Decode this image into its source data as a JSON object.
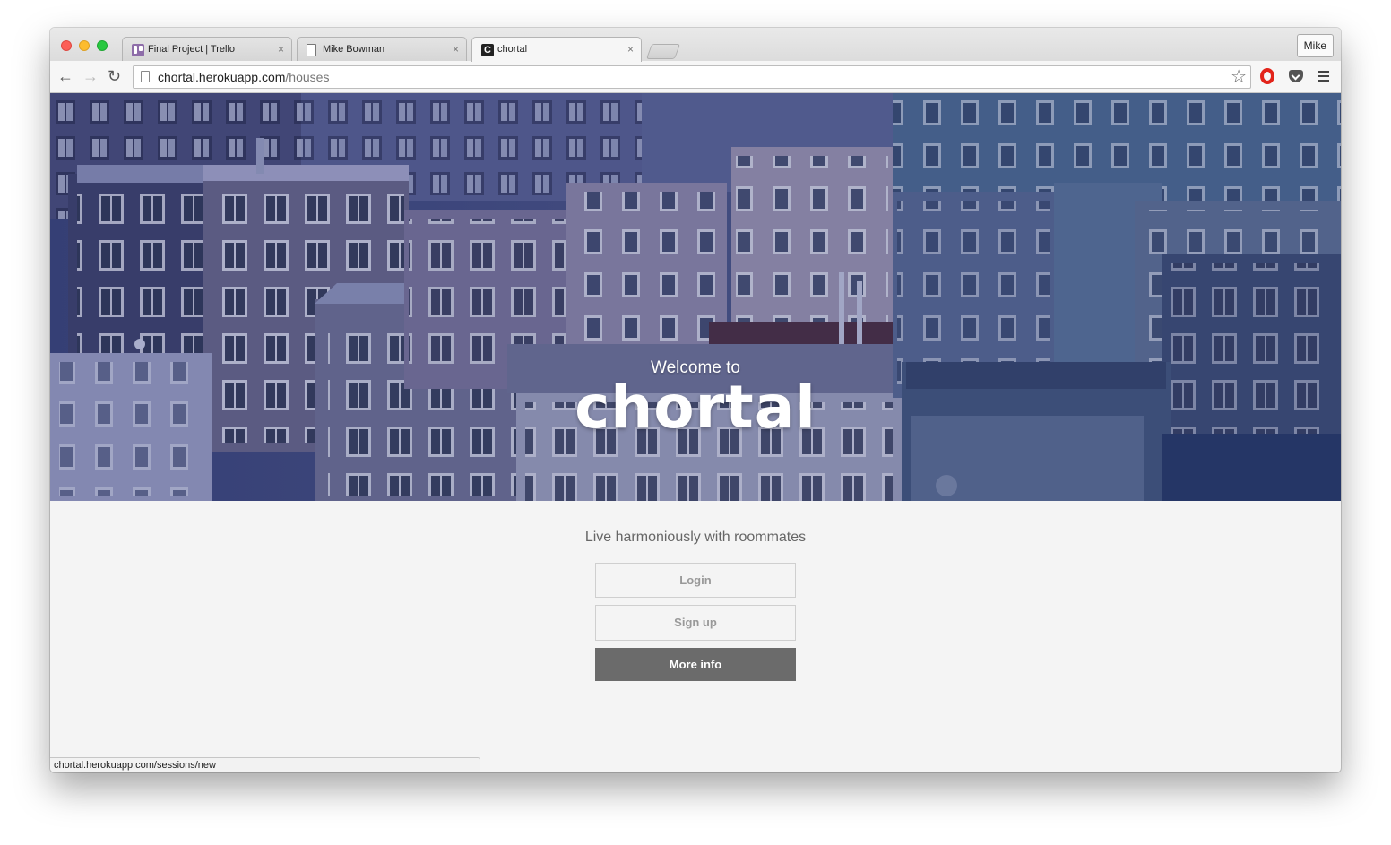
{
  "browser": {
    "tabs": [
      {
        "label": "Final Project | Trello",
        "icon": "trello-icon"
      },
      {
        "label": "Mike Bowman",
        "icon": "document-icon"
      },
      {
        "label": "chortal",
        "icon": "chortal-favicon",
        "favicon_text": "C"
      }
    ],
    "profile_label": "Mike",
    "url_host": "chortal.herokuapp.com",
    "url_path": "/houses",
    "tab_close_glyph": "×",
    "star_glyph": "☆",
    "back_glyph": "←",
    "forward_glyph": "→",
    "reload_glyph": "↻"
  },
  "hero": {
    "welcome": "Welcome to",
    "brand": "chortal"
  },
  "content": {
    "tagline": "Live harmoniously with roommates",
    "login_label": "Login",
    "signup_label": "Sign up",
    "more_info_label": "More info"
  },
  "status_url": "chortal.herokuapp.com/sessions/new",
  "colors": {
    "primary_button": "#6b6b6b",
    "background": "#f4f4f4",
    "hero_tint": "#2a3a7a"
  }
}
